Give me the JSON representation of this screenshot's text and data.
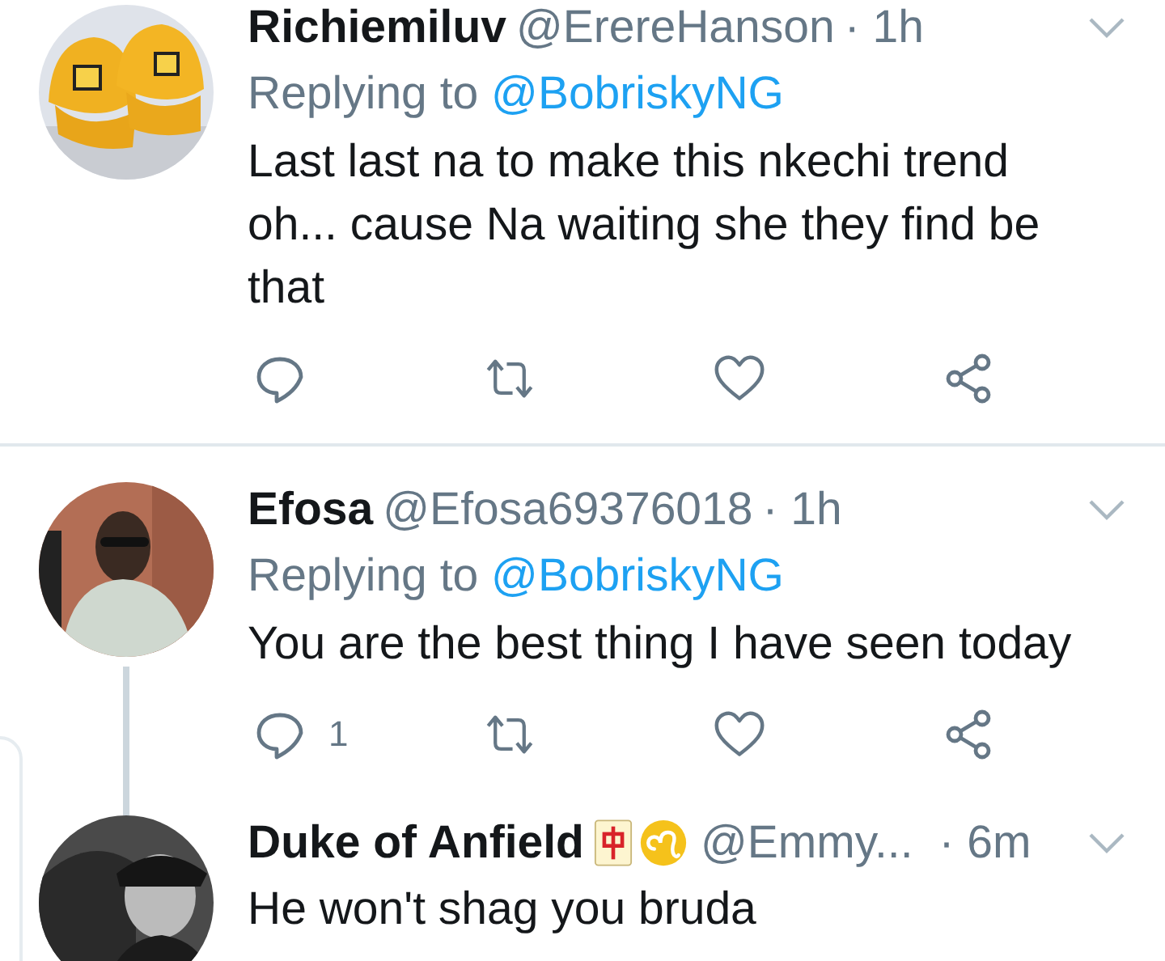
{
  "tweets": [
    {
      "name": "Richiemiluv",
      "handle": "@ErereHanson",
      "time": "· 1h",
      "reply_prefix": "Replying to",
      "reply_to": "@BobriskyNG",
      "lines": [
        "Last last na to make this nkechi trend",
        "oh...  cause Na waiting she they find be",
        "that"
      ],
      "thread_line": false,
      "badges": false,
      "actions": true,
      "divider": true
    },
    {
      "name": "Efosa",
      "handle": "@Efosa69376018",
      "time": "· 1h",
      "reply_prefix": "Replying to",
      "reply_to": "@BobriskyNG",
      "lines": [
        "You are the best thing I have seen today"
      ],
      "reply_count": "1",
      "thread_line": true,
      "badges": false,
      "actions": true,
      "divider": false
    },
    {
      "name": "Duke of Anfield",
      "handle": "@Emmy...",
      "time": "· 6m",
      "lines": [
        "He won't shag you bruda"
      ],
      "thread_line": false,
      "badges": true,
      "actions": false,
      "divider": false
    }
  ]
}
